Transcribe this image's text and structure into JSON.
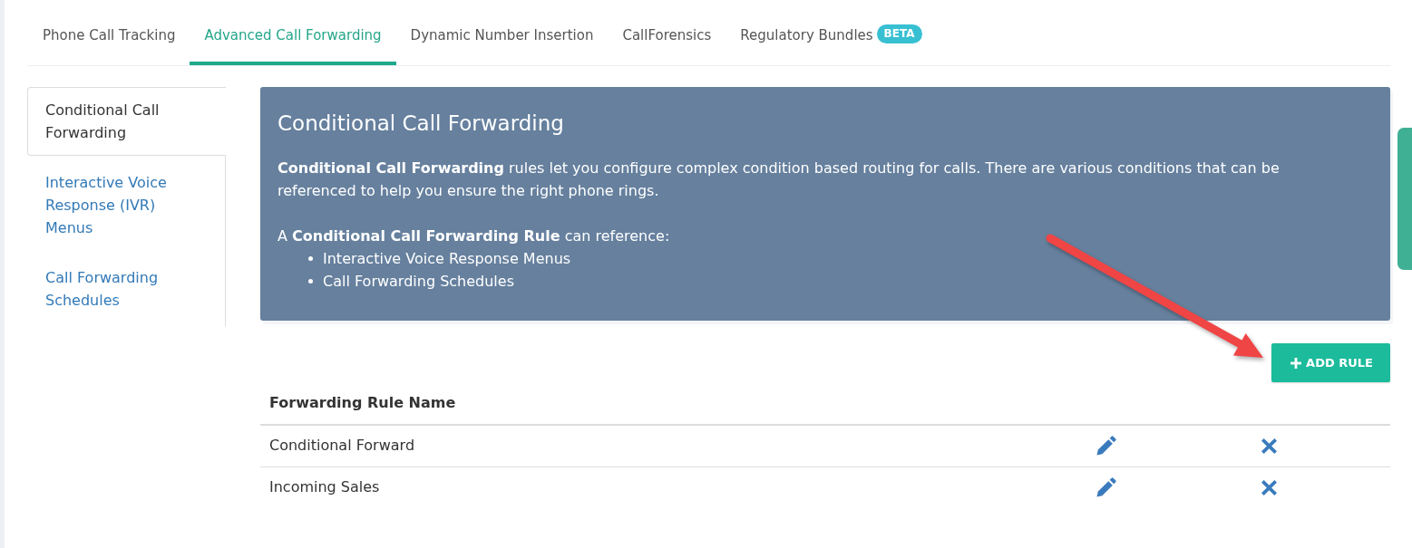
{
  "tabs": [
    {
      "label": "Phone Call Tracking",
      "selected": false
    },
    {
      "label": "Advanced Call Forwarding",
      "selected": true
    },
    {
      "label": "Dynamic Number Insertion",
      "selected": false
    },
    {
      "label": "CallForensics",
      "selected": false
    },
    {
      "label": "Regulatory Bundles",
      "selected": false,
      "badge": "BETA"
    }
  ],
  "sidebar": {
    "items": [
      {
        "label": "Conditional Call Forwarding",
        "selected": true
      },
      {
        "label": "Interactive Voice Response (IVR) Menus",
        "selected": false
      },
      {
        "label": "Call Forwarding Schedules",
        "selected": false
      }
    ]
  },
  "info_panel": {
    "title": "Conditional Call Forwarding",
    "description": "**Conditional Call Forwarding** rules let you configure complex condition based routing for calls. There are various conditions that can be referenced to help you ensure the right phone rings.",
    "list_intro": "A **Conditional Call Forwarding Rule** can reference:",
    "list_items": [
      "Interactive Voice Response Menus",
      "Call Forwarding Schedules"
    ]
  },
  "add_button": {
    "label": "ADD RULE"
  },
  "table": {
    "columns": [
      "Forwarding Rule Name"
    ],
    "rows": [
      {
        "name": "Conditional Forward"
      },
      {
        "name": "Incoming Sales"
      }
    ]
  }
}
